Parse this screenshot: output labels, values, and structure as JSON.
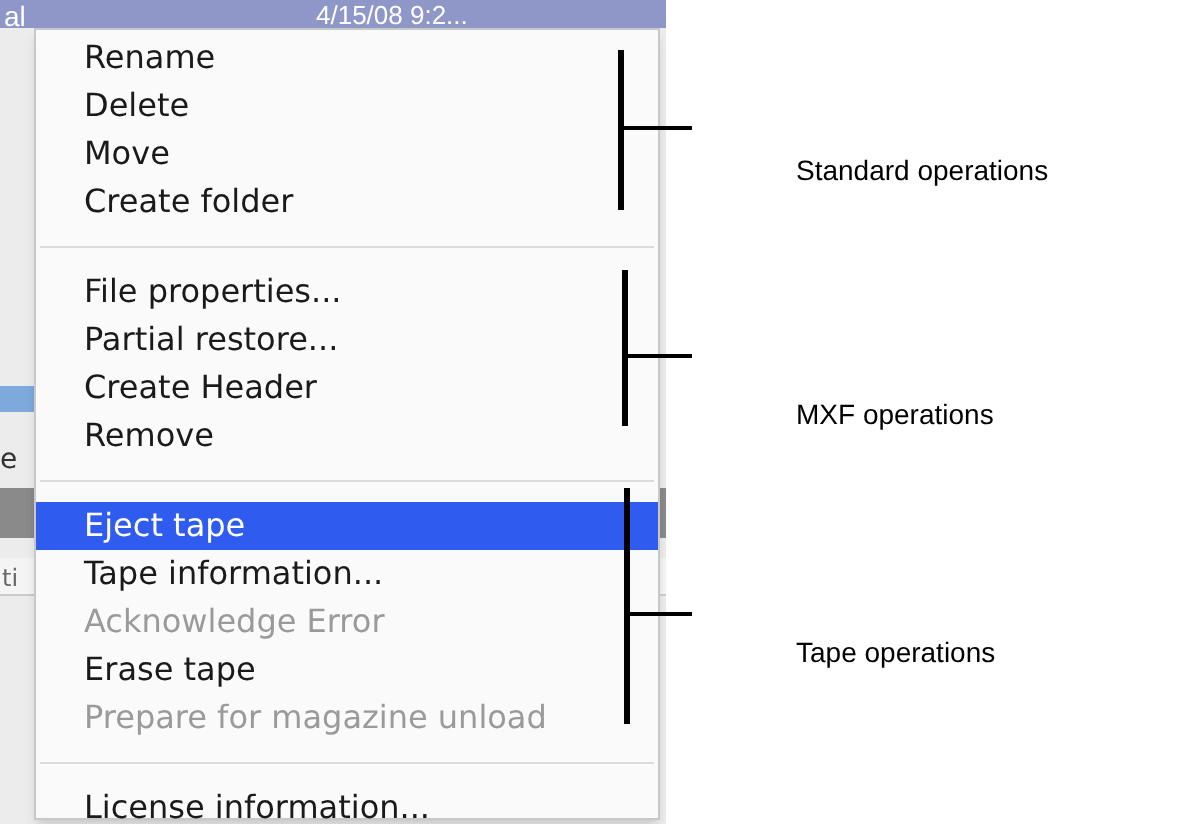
{
  "background": {
    "header_texts": [
      "al",
      "4/15/08 9:2..."
    ],
    "capacity": "e",
    "columns": [
      "ti"
    ]
  },
  "menu": {
    "groups": [
      {
        "items": [
          {
            "label": "Rename",
            "disabled": false,
            "selected": false
          },
          {
            "label": "Delete",
            "disabled": false,
            "selected": false
          },
          {
            "label": "Move",
            "disabled": false,
            "selected": false
          },
          {
            "label": "Create folder",
            "disabled": false,
            "selected": false
          }
        ]
      },
      {
        "items": [
          {
            "label": "File properties...",
            "disabled": false,
            "selected": false
          },
          {
            "label": "Partial restore...",
            "disabled": false,
            "selected": false
          },
          {
            "label": "Create Header",
            "disabled": false,
            "selected": false
          },
          {
            "label": "Remove",
            "disabled": false,
            "selected": false
          }
        ]
      },
      {
        "items": [
          {
            "label": "Eject tape",
            "disabled": false,
            "selected": true
          },
          {
            "label": "Tape information...",
            "disabled": false,
            "selected": false
          },
          {
            "label": "Acknowledge Error",
            "disabled": true,
            "selected": false
          },
          {
            "label": "Erase tape",
            "disabled": false,
            "selected": false
          },
          {
            "label": "Prepare for magazine unload",
            "disabled": true,
            "selected": false
          }
        ]
      },
      {
        "items": [
          {
            "label": "License information...",
            "disabled": false,
            "selected": false
          }
        ]
      }
    ]
  },
  "annotations": [
    {
      "label": "Standard operations"
    },
    {
      "label": "MXF operations"
    },
    {
      "label": "Tape operations"
    }
  ]
}
